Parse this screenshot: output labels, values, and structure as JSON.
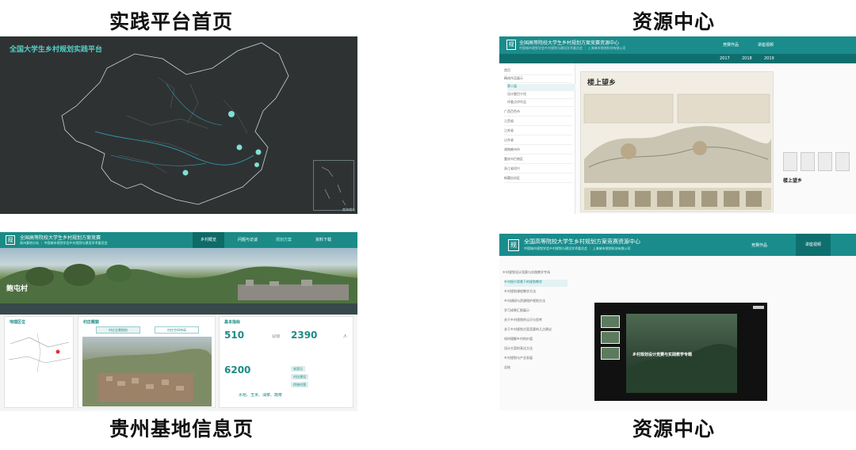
{
  "captions": {
    "top_left": "实践平台首页",
    "top_right": "资源中心",
    "bottom_left": "贵州基地信息页",
    "bottom_right": "资源中心"
  },
  "panel1": {
    "title": "全国大学生乡村规划实践平台",
    "inset_label": "南海诸岛"
  },
  "panel2": {
    "logo": "规",
    "header_title": "全国高等院校大学生乡村规划方案竞赛资源中心",
    "header_sub": "中国城市规划学会乡村规划与建设学术委员会 ｜ 上海城市规划科技有限公司",
    "nav": [
      "竞赛作品",
      "讲座视频"
    ],
    "years": [
      "2017",
      "2018",
      "2019"
    ],
    "sidebar": [
      "首页",
      "精选作品展示",
      "第二届",
      "设计题目介绍",
      "评委点评作品",
      "广西百色市",
      "江西省",
      "江苏省",
      "山东省",
      "湖南郴州市",
      "重庆市巴南区",
      "浙江省绍兴",
      "新疆自治区"
    ],
    "poster_title": "楼上望乡",
    "right_title": "楼上望乡"
  },
  "panel3": {
    "logo": "规",
    "header_title": "全国高等院校大学生乡村规划方案竞赛",
    "header_sub": "贵州基地分站 ｜ 中国城市规划学会乡村规划与建设学术委员会",
    "nav": [
      "乡村概览",
      "问题与访谈",
      "规划方案",
      "资料下载"
    ],
    "village": "鲍屯村",
    "card1_title": "地理区位",
    "card2_title": "村庄概貌",
    "card2_tabs": [
      "村庄全景航拍",
      "村庄空间布局"
    ],
    "card3_title": "基本指标",
    "num_area": "510",
    "num_households": "2390",
    "num_pop": "6200",
    "unit_area": "公顷",
    "unit_people": "人",
    "crops": "水稻、玉米、油菜、蔬菜",
    "tags": [
      "农家乐",
      "村庄建设",
      "传统村落"
    ]
  },
  "panel4": {
    "logo": "规",
    "header_title": "全国高等院校大学生乡村规划方案竞赛资源中心",
    "header_sub": "中国城市规划学会乡村规划与建设学术委员会 ｜ 上海城市规划科技有限公司",
    "nav": [
      "竞赛作品",
      "讲座视频"
    ],
    "sidebar": [
      "乡村规划设计竞赛与实践教学专场",
      "乡村振兴背景下的规划教学",
      "乡村规划课程教学方法",
      "乡村调研与资源保护规划方法",
      "学习成果汇报展示",
      "关于乡村规划的认识与思考",
      "关于乡村规划方案竞赛的几点建议",
      "如何理解乡村的价值",
      "设计方案的表达方法",
      "乡村规划与产业发展",
      "总结"
    ],
    "slide_title": "乡村规划设计竞赛与实践教学专题"
  }
}
